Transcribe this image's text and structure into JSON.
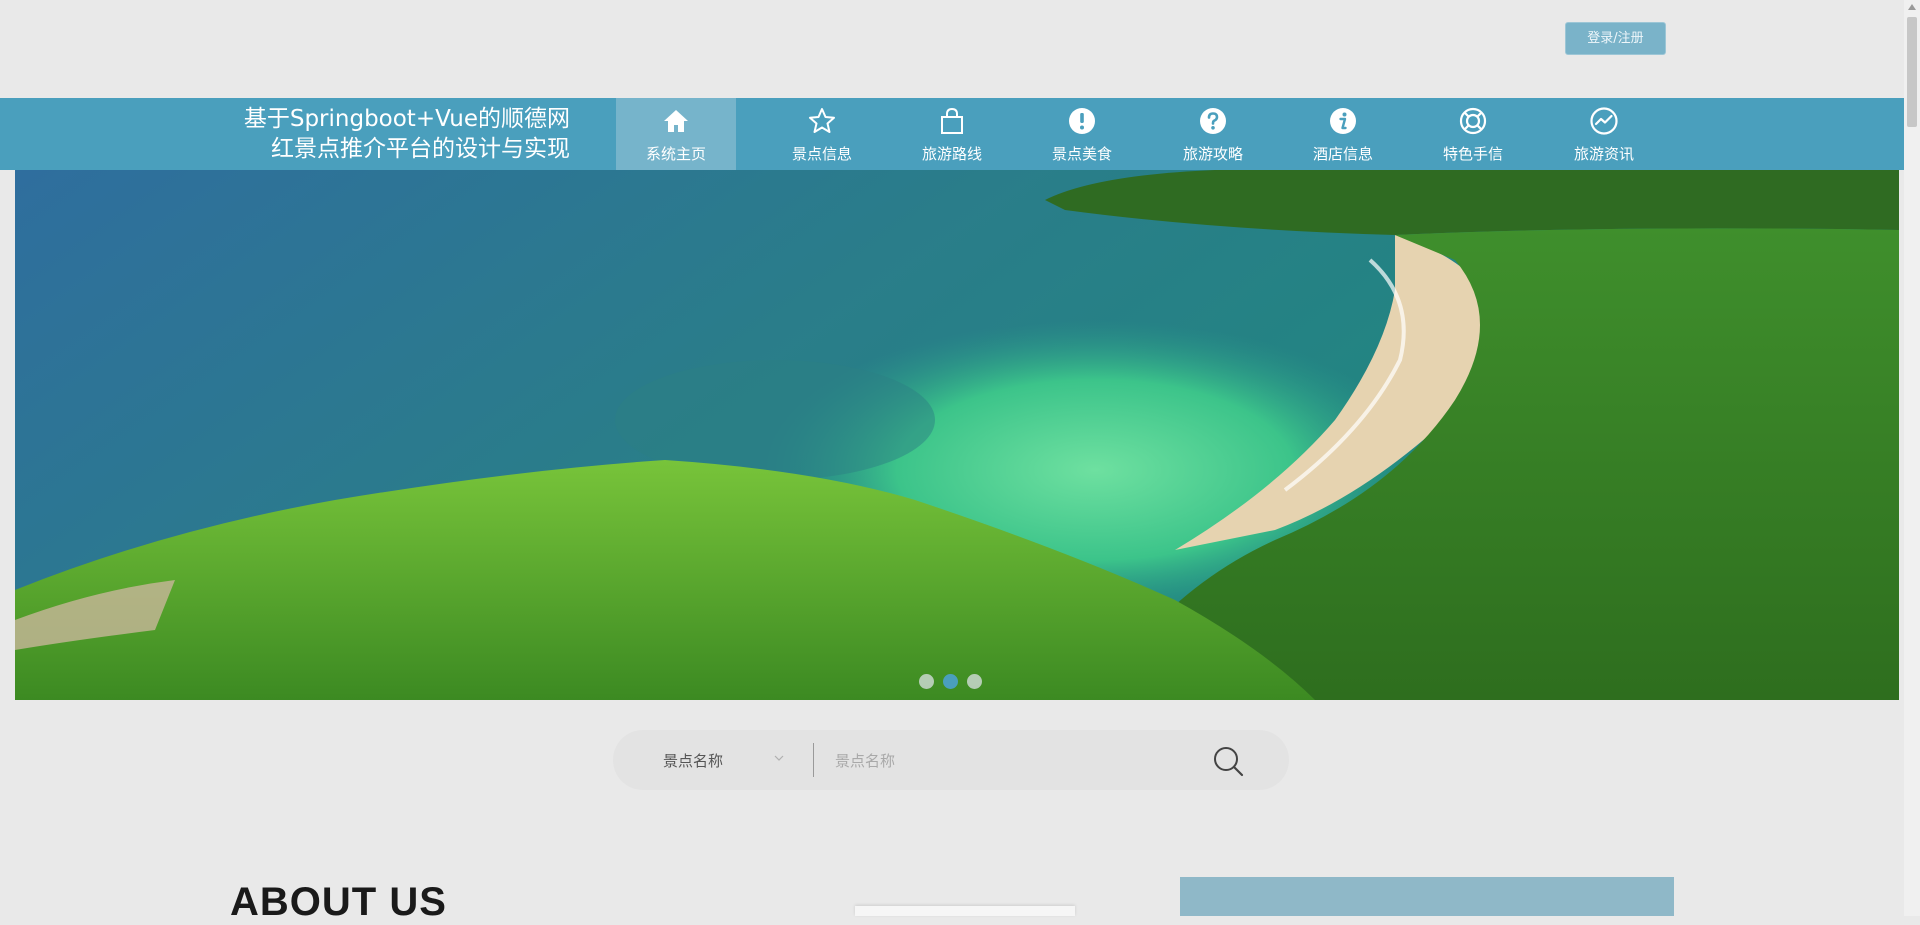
{
  "header": {
    "login_label": "登录/注册"
  },
  "site": {
    "title_line1": "基于Springboot+Vue的顺德网",
    "title_line2": "红景点推介平台的设计与实现"
  },
  "nav": {
    "items": [
      {
        "label": "系统主页",
        "icon": "home-icon",
        "active": true
      },
      {
        "label": "景点信息",
        "icon": "star-icon"
      },
      {
        "label": "旅游路线",
        "icon": "shopping-bag-icon"
      },
      {
        "label": "景点美食",
        "icon": "exclamation-circle-icon"
      },
      {
        "label": "旅游攻略",
        "icon": "question-circle-icon"
      },
      {
        "label": "酒店信息",
        "icon": "info-circle-icon"
      },
      {
        "label": "特色手信",
        "icon": "lifebuoy-icon"
      },
      {
        "label": "旅游资讯",
        "icon": "trend-circle-icon"
      }
    ]
  },
  "carousel": {
    "slide_count": 3,
    "active_index": 1
  },
  "search": {
    "field_selected": "景点名称",
    "placeholder": "景点名称"
  },
  "about": {
    "title": "ABOUT US"
  },
  "colors": {
    "nav_bg": "#4a9fbd",
    "nav_active": "#76b4cb",
    "login_btn": "#7ab3c9"
  }
}
